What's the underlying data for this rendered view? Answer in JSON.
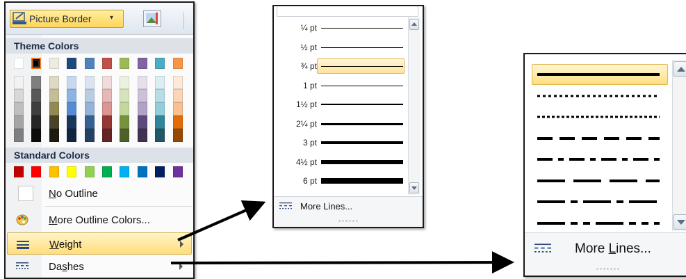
{
  "picture_border_menu": {
    "button_label": "Picture Border",
    "theme_colors_heading": "Theme Colors",
    "standard_colors_heading": "Standard Colors",
    "theme_colors_top": [
      "#ffffff",
      "#000000",
      "#eeece1",
      "#1f497d",
      "#4f81bd",
      "#c0504d",
      "#9bbb59",
      "#8064a2",
      "#4bacc6",
      "#f79646"
    ],
    "theme_shades": [
      [
        "#f2f2f2",
        "#7f7f7f",
        "#ddd9c3",
        "#c6d9f0",
        "#dbe5f1",
        "#f2dcdb",
        "#ebf1dd",
        "#e5e0ec",
        "#dbeef3",
        "#fdeada"
      ],
      [
        "#d8d8d8",
        "#595959",
        "#c4bd97",
        "#8db3e2",
        "#b8cce4",
        "#e5b9b7",
        "#d7e3bc",
        "#ccc1d9",
        "#b7dde8",
        "#fbd5b5"
      ],
      [
        "#bfbfbf",
        "#3f3f3f",
        "#938953",
        "#548dd4",
        "#95b3d7",
        "#d99694",
        "#c3d69b",
        "#b2a2c7",
        "#92cddc",
        "#fac08f"
      ],
      [
        "#a5a5a5",
        "#262626",
        "#494429",
        "#17365d",
        "#366092",
        "#953734",
        "#76923c",
        "#5f497a",
        "#31859b",
        "#e36c09"
      ],
      [
        "#7f7f7f",
        "#0c0c0c",
        "#1d1b10",
        "#0f243e",
        "#244061",
        "#632423",
        "#4f6128",
        "#3f3151",
        "#205867",
        "#974806"
      ]
    ],
    "standard_colors": [
      "#c00000",
      "#ff0000",
      "#ffc000",
      "#ffff00",
      "#92d050",
      "#00b050",
      "#00b0f0",
      "#0070c0",
      "#002060",
      "#7030a0"
    ],
    "items": {
      "no_outline": "No Outline",
      "more_outline_colors": "More Outline Colors...",
      "weight": "Weight",
      "dashes": "Dashes"
    },
    "selected_color": "#000000"
  },
  "weight_menu": {
    "weights": [
      {
        "label": "¼ pt",
        "thickness_pt": 0.25
      },
      {
        "label": "½ pt",
        "thickness_pt": 0.5
      },
      {
        "label": "¾ pt",
        "thickness_pt": 0.75,
        "selected": true
      },
      {
        "label": "1 pt",
        "thickness_pt": 1
      },
      {
        "label": "1½ pt",
        "thickness_pt": 1.5
      },
      {
        "label": "2¼ pt",
        "thickness_pt": 2.25
      },
      {
        "label": "3 pt",
        "thickness_pt": 3
      },
      {
        "label": "4½ pt",
        "thickness_pt": 4.5
      },
      {
        "label": "6 pt",
        "thickness_pt": 6
      }
    ],
    "more_lines": "More Lines..."
  },
  "dashes_menu": {
    "styles": [
      "solid",
      "round-dot",
      "square-dot",
      "dash",
      "dash-dot",
      "long-dash",
      "long-dash-dot",
      "long-dash-dot-dot"
    ],
    "selected_style": "solid",
    "more_lines": "More Lines..."
  },
  "colors": {
    "highlight": "#ffde7b",
    "section_header": "#dde2e9",
    "arrow": "#000000"
  }
}
